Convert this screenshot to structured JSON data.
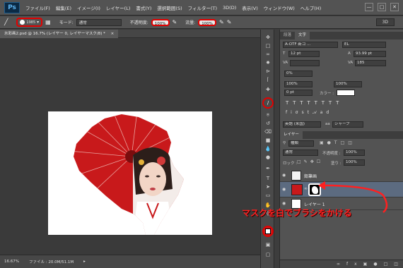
{
  "app": {
    "logo": "Ps",
    "brand_color": "#0b2a45"
  },
  "menu": [
    "ファイル(F)",
    "編集(E)",
    "イメージ(I)",
    "レイヤー(L)",
    "書式(Y)",
    "選択範囲(S)",
    "フィルター(T)",
    "3D(D)",
    "表示(V)",
    "ウィンドウ(W)",
    "ヘルプ(H)"
  ],
  "window_controls": [
    "—",
    "□",
    "✕"
  ],
  "options": {
    "brush_size": "1985",
    "mode_label": "モード:",
    "mode_value": "通常",
    "opacity_label": "不透明度:",
    "opacity_value": "100%",
    "flow_label": "流量:",
    "flow_value": "100%",
    "workspace": "3D"
  },
  "document": {
    "tab_title": "水彩画2.psd @ 16.7% (レイヤー 0, レイヤーマスク/8) *",
    "zoom": "16.67%",
    "file_info": "ファイル : 20.0M/51.1M"
  },
  "character_panel": {
    "tabs": [
      "段落",
      "文字"
    ],
    "font": "A-OTF 新ゴ ...",
    "font_style": "EL",
    "size": "12 pt",
    "leading": "93.99 pt",
    "tracking": "185",
    "kerning_pct": "0%",
    "vscale": "100%",
    "hscale": "100%",
    "baseline": "0 pt",
    "color_label": "カラー :",
    "language": "英語 (米国)",
    "antialias": "シャープ"
  },
  "layers_panel": {
    "tab": "レイヤー",
    "kind": "種類",
    "blend_mode": "通常",
    "opacity_label": "不透明度 :",
    "opacity": "100%",
    "lock_label": "ロック :",
    "fill_label": "塗り :",
    "fill": "100%",
    "layers": [
      {
        "name": "鉛筆画",
        "thumb": "sketch"
      },
      {
        "name": "",
        "thumb": "photo-mask"
      },
      {
        "name": "レイヤー 1",
        "thumb": "white"
      }
    ]
  },
  "annotation": {
    "text": "マスクを白でブラシをかける",
    "color": "#ff2020"
  },
  "colors": {
    "umbrella": "#c8191b",
    "highlight_ring": "#e30000"
  }
}
